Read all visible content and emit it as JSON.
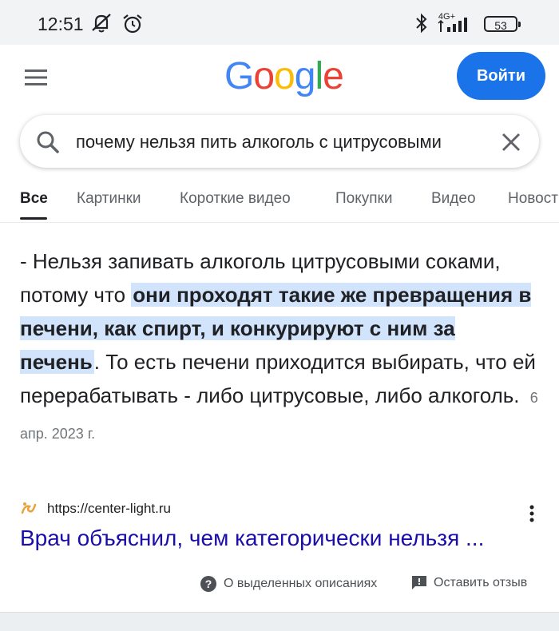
{
  "status_bar": {
    "time": "12:51",
    "network": "4G+",
    "battery": "53"
  },
  "header": {
    "logo": "Google",
    "signin_label": "Войти"
  },
  "search": {
    "query": "почему нельзя пить алкоголь с цитрусовыми"
  },
  "tabs": [
    {
      "label": "Все",
      "active": true
    },
    {
      "label": "Картинки",
      "active": false
    },
    {
      "label": "Короткие видео",
      "active": false
    },
    {
      "label": "Покупки",
      "active": false
    },
    {
      "label": "Видео",
      "active": false
    },
    {
      "label": "Новости",
      "active": false
    }
  ],
  "featured_snippet": {
    "text_before": "- Нельзя запивать алкоголь цитрусовыми соками, потому что ",
    "highlight": "они проходят такие же превращения в печени, как спирт, и конкурируют с ним за печень",
    "text_after": ". То есть печени приходится выбирать, что ей перерабатывать - либо цитрусовые, либо алкоголь.",
    "date": "6 апр. 2023 г."
  },
  "result": {
    "url": "https://center-light.ru",
    "title": "Врач объяснил, чем категорически нельзя ..."
  },
  "footer": {
    "about_label": "О выделенных описаниях",
    "feedback_label": "Оставить отзыв"
  },
  "colors": {
    "accent": "#1a73e8",
    "link": "#1a0dab",
    "highlight": "#d2e3fc",
    "status_bar_bg": "#f1f3f4"
  }
}
